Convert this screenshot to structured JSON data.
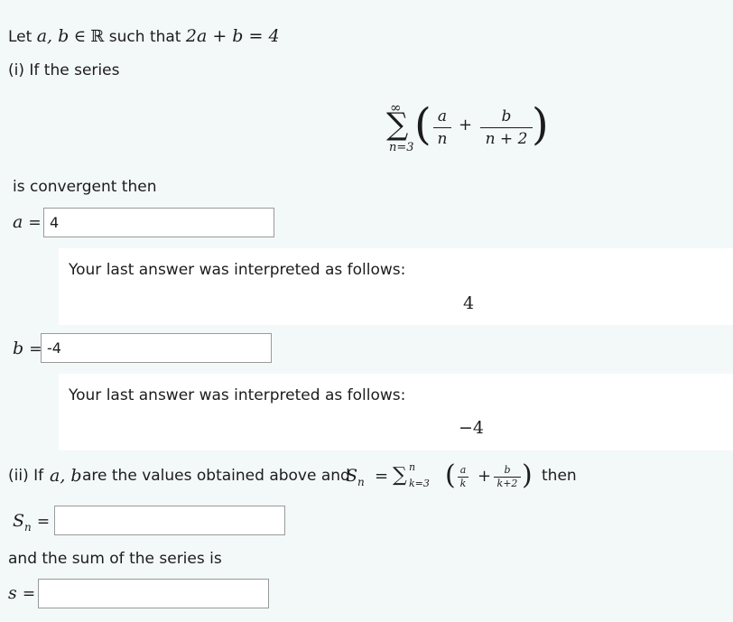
{
  "intro": {
    "let": "Let",
    "vars": "a, b",
    "in": "∈",
    "reals": "ℝ",
    "such_that": "such that",
    "constraint": "2a + b = 4"
  },
  "part_i": {
    "label": "(i) If the series",
    "sum_upper": "∞",
    "sum_symbol": "∑",
    "sum_lower": "n=3",
    "term1_num": "a",
    "term1_den": "n",
    "plus": "+",
    "term2_num": "b",
    "term2_den": "n + 2",
    "convergent_text": "is convergent then"
  },
  "answers": {
    "a": {
      "label": "a",
      "eq": "=",
      "value": "4",
      "interpreted_label": "Your last answer was interpreted as follows:",
      "interpreted_value": "4"
    },
    "b": {
      "label": "b",
      "eq": "=",
      "value": "-4",
      "interpreted_label": "Your last answer was interpreted as follows:",
      "interpreted_value": "−4"
    }
  },
  "part_ii": {
    "prefix": "(ii) If",
    "vars": "a, b",
    "mid": "are the values obtained above and",
    "sn_var": "S",
    "sn_sub": "n",
    "eq": "=",
    "sum_symbol": "∑",
    "sum_upper": "n",
    "sum_lower": "k=3",
    "t1_num": "a",
    "t1_den": "k",
    "plus": "+",
    "t2_num": "b",
    "t2_den": "k+2",
    "suffix": "then",
    "sn_input_label": "S",
    "sn_input_sub": "n",
    "sn_input_eq": "=",
    "sn_value": "",
    "sum_text": "and the sum of the series is",
    "s_label": "s",
    "s_eq": "=",
    "s_value": ""
  }
}
